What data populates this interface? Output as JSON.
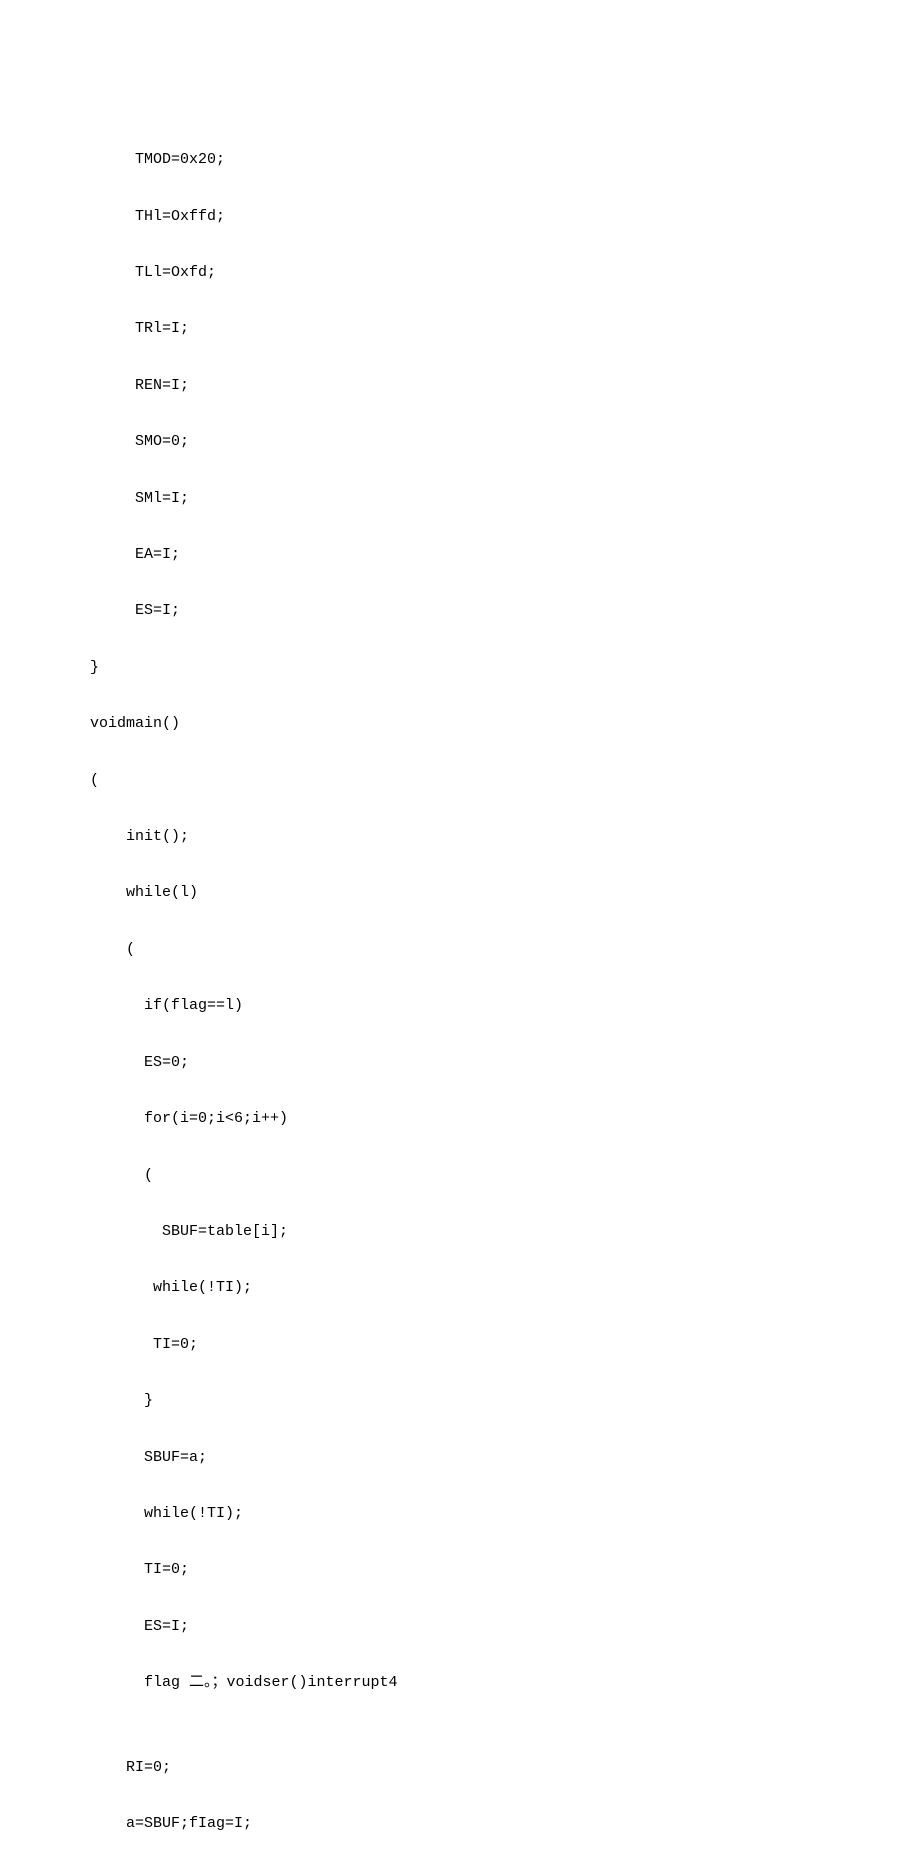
{
  "code": {
    "lines": [
      "     TMOD=0x20;",
      "     THl=Oxffd;",
      "     TLl=Oxfd;",
      "     TRl=I;",
      "     REN=I;",
      "     SMO=0;",
      "     SMl=I;",
      "     EA=I;",
      "     ES=I;",
      "}",
      "voidmain()",
      "(",
      "    init();",
      "    while(l)",
      "    (",
      "      if(flag==l)",
      "      ES=0;",
      "      for(i=0;i<6;i++)",
      "      (",
      "        SBUF=table[i];",
      "       while(!TI);",
      "       TI=0;",
      "      }",
      "      SBUF=a;",
      "      while(!TI);",
      "      TI=0;",
      "      ES=I;",
      "      flag 二。；voidser()interrupt4",
      "",
      "    RI=0;",
      "    a=SBUF;fIag=I;"
    ]
  }
}
